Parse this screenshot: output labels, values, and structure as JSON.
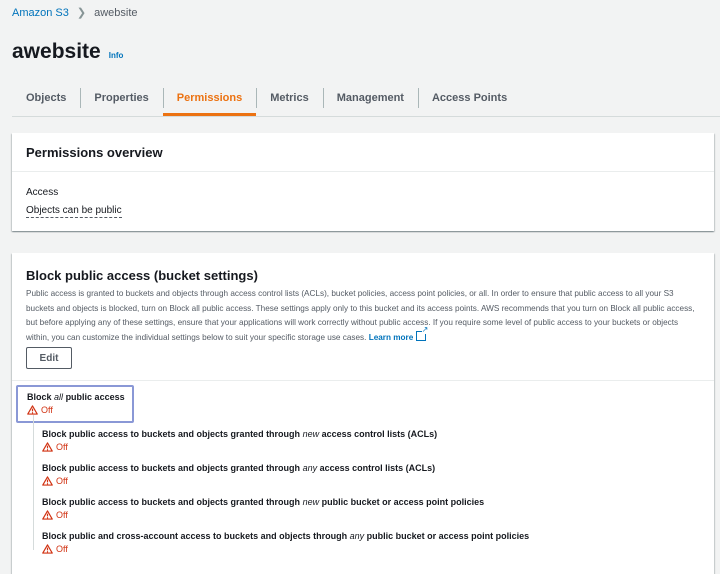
{
  "breadcrumb": {
    "root": "Amazon S3",
    "current": "awebsite"
  },
  "header": {
    "title": "awebsite",
    "info": "Info"
  },
  "tabs": [
    {
      "label": "Objects"
    },
    {
      "label": "Properties"
    },
    {
      "label": "Permissions"
    },
    {
      "label": "Metrics"
    },
    {
      "label": "Management"
    },
    {
      "label": "Access Points"
    }
  ],
  "active_tab": "Permissions",
  "permissions_overview": {
    "title": "Permissions overview",
    "access_label": "Access",
    "access_value": "Objects can be public"
  },
  "block_public_access": {
    "title": "Block public access (bucket settings)",
    "description": "Public access is granted to buckets and objects through access control lists (ACLs), bucket policies, access point policies, or all. In order to ensure that public access to all your S3 buckets and objects is blocked, turn on Block all public access. These settings apply only to this bucket and its access points. AWS recommends that you turn on Block all public access, but before applying any of these settings, ensure that your applications will work correctly without public access. If you require some level of public access to your buckets or objects within, you can customize the individual settings below to suit your specific storage use cases.",
    "learn_more": "Learn more",
    "edit_label": "Edit",
    "block_all": {
      "prefix": "Block",
      "emphasis": "all",
      "suffix": "public access",
      "status": "Off"
    },
    "settings": [
      {
        "prefix": "Block public access to buckets and objects granted through",
        "emphasis": "new",
        "suffix": "access control lists (ACLs)",
        "status": "Off"
      },
      {
        "prefix": "Block public access to buckets and objects granted through",
        "emphasis": "any",
        "suffix": "access control lists (ACLs)",
        "status": "Off"
      },
      {
        "prefix": "Block public access to buckets and objects granted through",
        "emphasis": "new",
        "suffix": "public bucket or access point policies",
        "status": "Off"
      },
      {
        "prefix": "Block public and cross-account access to buckets and objects through",
        "emphasis": "any",
        "suffix": "public bucket or access point policies",
        "status": "Off"
      }
    ]
  },
  "icons": {
    "chevron": "chevron-right-icon",
    "warning": "warning-icon",
    "external": "external-link-icon"
  },
  "colors": {
    "link": "#0073bb",
    "active_tab": "#ec7211",
    "status_off": "#d13212",
    "focus_outline": "#8a98d6"
  }
}
